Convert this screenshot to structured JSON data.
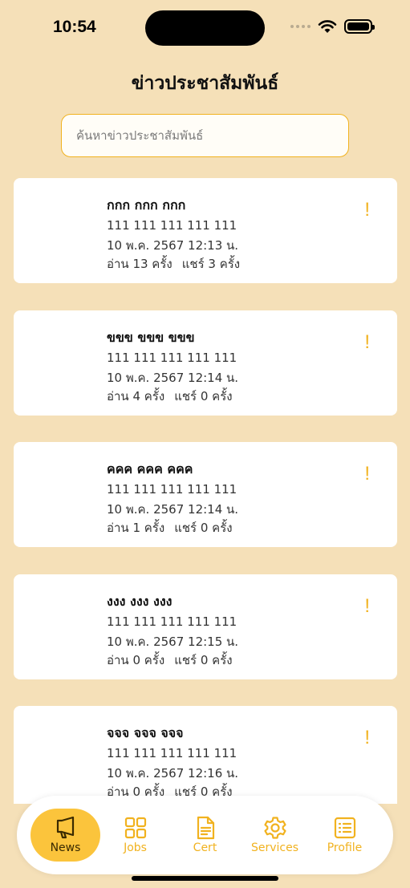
{
  "status_bar": {
    "time": "10:54"
  },
  "header": {
    "title": "ข่าวประชาสัมพันธ์"
  },
  "search": {
    "placeholder": "ค้นหาข่าวประชาสัมพันธ์",
    "value": ""
  },
  "news": [
    {
      "title": "กกก กกก กกก",
      "body": "111 111 111 111 111",
      "date": "10 พ.ค. 2567 12:13 น.",
      "reads": "อ่าน 13 ครั้ง",
      "shares": "แชร์ 3 ครั้ง",
      "alert": "!"
    },
    {
      "title": "ขขข ขขข ขขข",
      "body": "111 111 111 111 111",
      "date": "10 พ.ค. 2567 12:14 น.",
      "reads": "อ่าน 4 ครั้ง",
      "shares": "แชร์ 0 ครั้ง",
      "alert": "!"
    },
    {
      "title": "คคค คคค คคค",
      "body": "111 111 111 111 111",
      "date": "10 พ.ค. 2567 12:14 น.",
      "reads": "อ่าน 1 ครั้ง",
      "shares": "แชร์ 0 ครั้ง",
      "alert": "!"
    },
    {
      "title": "งงง งงง งงง",
      "body": "111 111 111 111 111",
      "date": "10 พ.ค. 2567 12:15 น.",
      "reads": "อ่าน 0 ครั้ง",
      "shares": "แชร์ 0 ครั้ง",
      "alert": "!"
    },
    {
      "title": "จจจ จจจ จจจ",
      "body": "111 111 111 111 111",
      "date": "10 พ.ค. 2567 12:16 น.",
      "reads": "อ่าน 0 ครั้ง",
      "shares": "แชร์ 0 ครั้ง",
      "alert": "!"
    }
  ],
  "tabs": [
    {
      "label": "News",
      "icon": "megaphone-icon",
      "active": true
    },
    {
      "label": "Jobs",
      "icon": "grid-icon",
      "active": false
    },
    {
      "label": "Cert",
      "icon": "document-icon",
      "active": false
    },
    {
      "label": "Services",
      "icon": "gear-icon",
      "active": false
    },
    {
      "label": "Profile",
      "icon": "list-icon",
      "active": false
    }
  ],
  "colors": {
    "background": "#f5e0b8",
    "accent": "#f1b21f",
    "active_tab": "#fbc43c"
  }
}
